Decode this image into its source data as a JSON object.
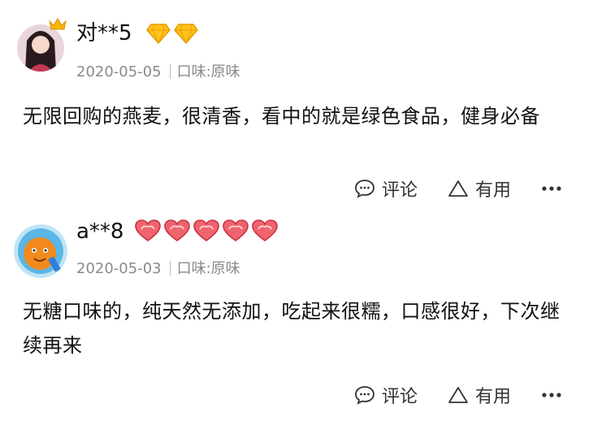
{
  "reviews": [
    {
      "username": "对**5",
      "badge_type": "diamond",
      "badge_count": 2,
      "date": "2020-05-05",
      "flavor": "口味:原味",
      "content": "无限回购的燕麦，很清香，看中的就是绿色食品，健身必备",
      "comment_label": "评论",
      "useful_label": "有用"
    },
    {
      "username": "a**8",
      "badge_type": "heart",
      "badge_count": 5,
      "date": "2020-05-03",
      "flavor": "口味:原味",
      "content": "无糖口味的，纯天然无添加，吃起来很糯，口感很好，下次继续再来",
      "comment_label": "评论",
      "useful_label": "有用"
    }
  ],
  "icons": {
    "comment": "comment-bubble-icon",
    "useful": "triangle-outline-icon",
    "more": "more-dots-icon",
    "diamond": "gold-diamond-icon",
    "heart": "red-heart-icon",
    "crown": "crown-icon"
  },
  "colors": {
    "diamond": "#f5b400",
    "heart": "#e8434f",
    "meta_text": "#8a8a8a"
  }
}
